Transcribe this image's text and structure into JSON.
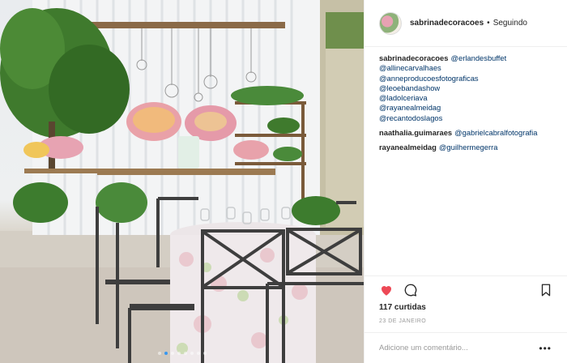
{
  "post": {
    "username": "sabrinadecoracoes",
    "separator": "•",
    "follow_state": "Seguindo",
    "images_count": 8,
    "active_image_index": 1
  },
  "comments": [
    {
      "user": "sabrinadecoracoes",
      "mentions": [
        "@erlandesbuffet",
        "@allinecarvalhaes",
        "@anneproducoesfotograficas",
        "@leoebandashow",
        "@ladolceriava",
        "@rayanealmeidag",
        "@recantodoslagos"
      ]
    },
    {
      "user": "naathalia.guimaraes",
      "mentions": [
        "@gabrielcabralfotografia"
      ]
    },
    {
      "user": "rayanealmeidag",
      "mentions": [
        "@guilhermegerra"
      ]
    }
  ],
  "actions": {
    "like_icon": "heart-icon",
    "comment_icon": "comment-icon",
    "save_icon": "bookmark-icon",
    "liked": true,
    "like_color": "#ed4956"
  },
  "likes_text": "117 curtidas",
  "date_text": "23 DE JANEIRO",
  "add_comment": {
    "placeholder": "Adicione um comentário...",
    "more_label": "•••"
  },
  "colors": {
    "link": "#003569",
    "muted": "#999999",
    "border": "#efefef",
    "dot_active": "#3897f0"
  }
}
